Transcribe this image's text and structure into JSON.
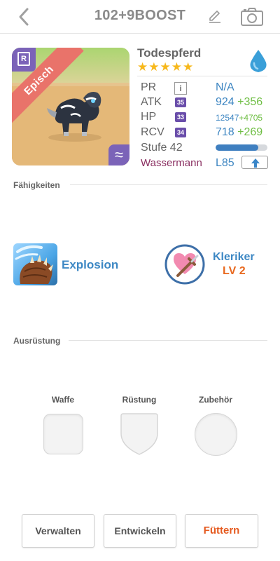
{
  "header": {
    "title": "102+9BOOST",
    "back_icon": "chevron-left-icon",
    "edit_icon": "pencil-icon",
    "camera_icon": "camera-icon"
  },
  "monster": {
    "name": "Todespferd",
    "rarity_label": "Episch",
    "rank_letter": "R",
    "stars": 5,
    "stars_text": "★★★★★",
    "element_icon": "water-drop-icon",
    "element_color": "#3a9fd8"
  },
  "stats": {
    "pr": {
      "label": "PR",
      "value": "N/A",
      "info": "i"
    },
    "atk": {
      "label": "ATK",
      "level": "35",
      "value": "924",
      "bonus": "+356"
    },
    "hp": {
      "label": "HP",
      "level": "33",
      "value": "12547",
      "bonus": "+4705"
    },
    "rcv": {
      "label": "RCV",
      "level": "34",
      "value": "718",
      "bonus": "+269"
    },
    "stufe": {
      "label": "Stufe 42",
      "exp_fraction": 0.82
    },
    "sign": {
      "label": "Wassermann",
      "lv": "L85"
    }
  },
  "sections": {
    "skills": "Fähigkeiten",
    "equipment": "Ausrüstung"
  },
  "skills": {
    "active": {
      "name": "Explosion"
    },
    "leader": {
      "name": "Kleriker",
      "level": "LV 2"
    }
  },
  "equipment": {
    "weapon": "Waffe",
    "armor": "Rüstung",
    "accessory": "Zubehör"
  },
  "buttons": {
    "manage": "Verwalten",
    "evolve": "Entwickeln",
    "feed": "Füttern"
  },
  "colors": {
    "accent_blue": "#3d88c4",
    "bonus_green": "#6fbe44",
    "feed_orange": "#e55a1f",
    "rarity_red": "#e9736a",
    "badge_purple": "#6a4eaa",
    "star_gold": "#f7b81b"
  }
}
